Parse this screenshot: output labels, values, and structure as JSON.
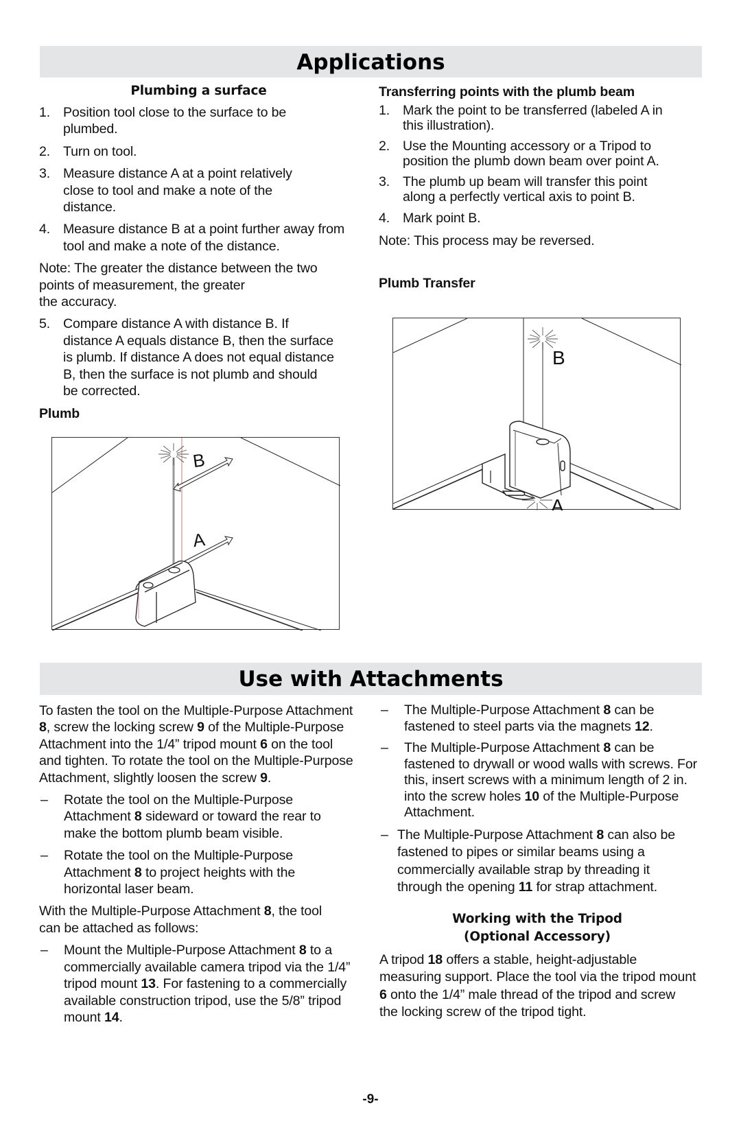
{
  "sections": {
    "applications": {
      "title": "Applications",
      "plumbing": {
        "heading": "Plumbing a surface",
        "steps": [
          {
            "num": "1.",
            "text": "Position tool close to the surface to be plumbed."
          },
          {
            "num": "2.",
            "text": "Turn on tool."
          },
          {
            "num": "3.",
            "text": "Measure distance A at a point relatively close to tool and make a note of the distance."
          },
          {
            "num": "4.",
            "text": "Measure distance B at a point further away from tool and make a note of the distance."
          }
        ],
        "note_line1": "Note: The greater the distance between the two",
        "note_line2": "points of measurement, the greater",
        "note_line3": "the accuracy.",
        "step5": {
          "num": "5.",
          "text": "Compare distance A with distance B. If distance A equals distance B, then the surface is plumb. If distance A does not equal distance B, then the surface is not plumb and should be corrected."
        },
        "figure_caption": "Plumb",
        "figure_labels": {
          "upper": "B",
          "lower": "A"
        }
      },
      "transferring": {
        "heading": "Transferring points with the plumb beam",
        "steps": [
          {
            "num": "1.",
            "text": "Mark the point to be transferred (labeled A in this illustration)."
          },
          {
            "num": "2.",
            "text": "Use the Mounting accessory or a Tripod to position the plumb down beam over point A."
          },
          {
            "num": "3.",
            "text": "The plumb up beam will transfer this point along a perfectly vertical axis to point B."
          },
          {
            "num": "4.",
            "text": "Mark point B."
          }
        ],
        "note": "Note: This process may be reversed.",
        "figure_caption": "Plumb Transfer",
        "figure_labels": {
          "upper": "B",
          "lower": "A"
        }
      }
    },
    "attachments": {
      "title": "Use with Attachments",
      "intro": {
        "t1": "To fasten the tool on the Multiple-Purpose Attachment ",
        "b1": "8",
        "t2": ", screw the locking screw ",
        "b2": "9",
        "t3": " of the Multiple-Purpose Attachment  into the 1/4” tripod mount ",
        "b3": "6",
        "t4": " on the tool and tighten. To rotate the tool on the Multiple-Purpose Attachment, slightly loosen the screw ",
        "b4": "9",
        "t5": "."
      },
      "rotate_items": [
        {
          "dash": "–",
          "t1": "Rotate the tool on the Multiple-Purpose Attachment  ",
          "b1": "8",
          "t2": " sideward or toward the rear to make the bottom plumb beam visible."
        },
        {
          "dash": "–",
          "t1": "Rotate the tool on the Multiple-Purpose Attachment  ",
          "b1": "8",
          "t2": " to project heights with the horizontal laser beam."
        }
      ],
      "with_attachment": {
        "t1": "With the Multiple-Purpose Attachment  ",
        "b1": "8",
        "t2": ", the tool can be attached as follows:"
      },
      "mount_item": {
        "dash": "–",
        "t1": "Mount the Multiple-Purpose Attachment ",
        "b1": "8",
        "t2": " to a commercially available camera tripod via the 1/4” tripod mount ",
        "b2": "13",
        "t3": ". For fastening to a commercially available construction tripod, use the 5/8” tripod   mount ",
        "b3": "14",
        "t4": "."
      },
      "right_items": [
        {
          "dash": "–",
          "t1": "The Multiple-Purpose Attachment ",
          "b1": "8",
          "t2": " can be fastened to steel parts via the magnets ",
          "b2": "12",
          "t3": "."
        },
        {
          "dash": "–",
          "t1": "The Multiple-Purpose Attachment ",
          "b1": "8",
          "t2": " can be fastened to drywall or wood walls with screws. For this, insert screws with a minimum length of 2 in. into the screw holes ",
          "b2": "10",
          "t3": " of the Multiple-Purpose Attachment."
        }
      ],
      "strap_item": {
        "dash": "–",
        "t1": "The Multiple-Purpose Attachment ",
        "b1": "8",
        "t2": " can also be fastened to pipes or similar beams using a commercially available strap by threading it through the opening ",
        "b2": "11",
        "t3": " for strap attachment."
      },
      "tripod": {
        "heading_line1": "Working with the Tripod",
        "heading_line2": "(Optional Accessory)",
        "t1": "A tripod ",
        "b1": "18",
        "t2": " offers a stable, height-adjustable measuring support. Place the tool via the tripod mount ",
        "b2": "6",
        "t3": " onto the 1/4” male thread of the tripod and screw the locking screw of the tripod tight."
      }
    }
  },
  "page_number": "-9-"
}
